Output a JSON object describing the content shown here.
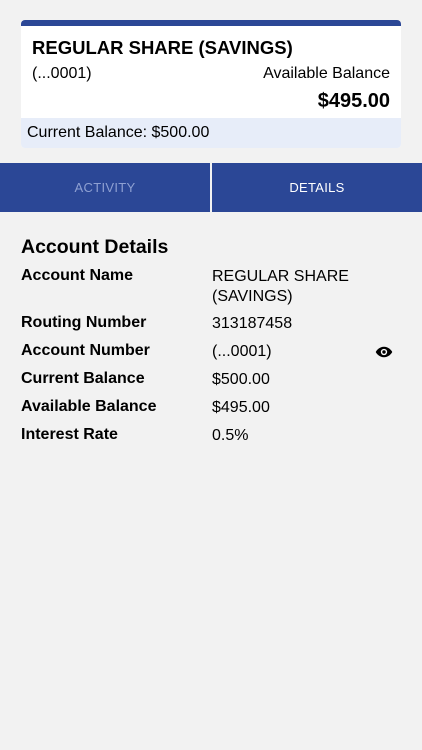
{
  "account_card": {
    "title": "REGULAR SHARE (SAVINGS)",
    "masked_number": "(...0001)",
    "available_label": "Available Balance",
    "available_value": "$495.00",
    "current_balance_text": "Current Balance: $500.00"
  },
  "tabs": [
    {
      "label": "ACTIVITY",
      "active": false
    },
    {
      "label": "DETAILS",
      "active": true
    }
  ],
  "details": {
    "title": "Account Details",
    "rows": [
      {
        "label": "Account Name",
        "value": "REGULAR SHARE (SAVINGS)"
      },
      {
        "label": "Routing Number",
        "value": "313187458"
      },
      {
        "label": "Account Number",
        "value": "(...0001)",
        "icon": "eye-icon"
      },
      {
        "label": "Current Balance",
        "value": "$500.00"
      },
      {
        "label": "Available Balance",
        "value": "$495.00"
      },
      {
        "label": "Interest Rate",
        "value": "0.5%"
      }
    ]
  },
  "colors": {
    "brand_blue": "#2b4796",
    "inactive_tab_text": "#8ea0d2",
    "balance_strip": "#e7edf9",
    "background": "#f2f2f2"
  }
}
